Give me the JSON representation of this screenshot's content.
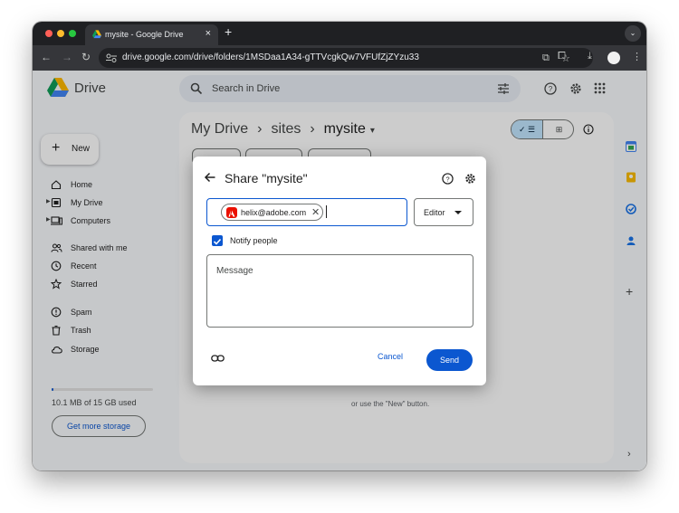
{
  "browser": {
    "tab_title": "mysite - Google Drive",
    "tab_close": "×",
    "new_tab": "+",
    "url": "drive.google.com/drive/folders/1MSDaa1A34-gTTVcgkQw7VFUfZjZYzu33"
  },
  "header": {
    "app_name": "Drive",
    "search_placeholder": "Search in Drive"
  },
  "sidebar": {
    "new_label": "New",
    "items": [
      {
        "label": "Home",
        "icon": "home-icon"
      },
      {
        "label": "My Drive",
        "icon": "my-drive-icon"
      },
      {
        "label": "Computers",
        "icon": "computers-icon"
      },
      {
        "label": "Shared with me",
        "icon": "shared-icon"
      },
      {
        "label": "Recent",
        "icon": "clock-icon"
      },
      {
        "label": "Starred",
        "icon": "star-icon"
      },
      {
        "label": "Spam",
        "icon": "spam-icon"
      },
      {
        "label": "Trash",
        "icon": "trash-icon"
      },
      {
        "label": "Storage",
        "icon": "cloud-icon"
      }
    ],
    "storage_text": "10.1 MB of 15 GB used",
    "storage_used_fraction": 0.001,
    "get_storage_label": "Get more storage"
  },
  "main": {
    "breadcrumb": [
      "My Drive",
      "sites",
      "mysite"
    ],
    "breadcrumb_sep": "›",
    "empty_hint": "or use the \"New\" button."
  },
  "dialog": {
    "title": "Share \"mysite\"",
    "recipient": "helix@adobe.com",
    "role": "Editor",
    "notify_label": "Notify people",
    "notify_checked": true,
    "message_placeholder": "Message",
    "cancel_label": "Cancel",
    "send_label": "Send"
  },
  "colors": {
    "accent": "#0b57d0",
    "selected_toggle": "#c2e7ff",
    "adobe_red": "#eb1000"
  }
}
